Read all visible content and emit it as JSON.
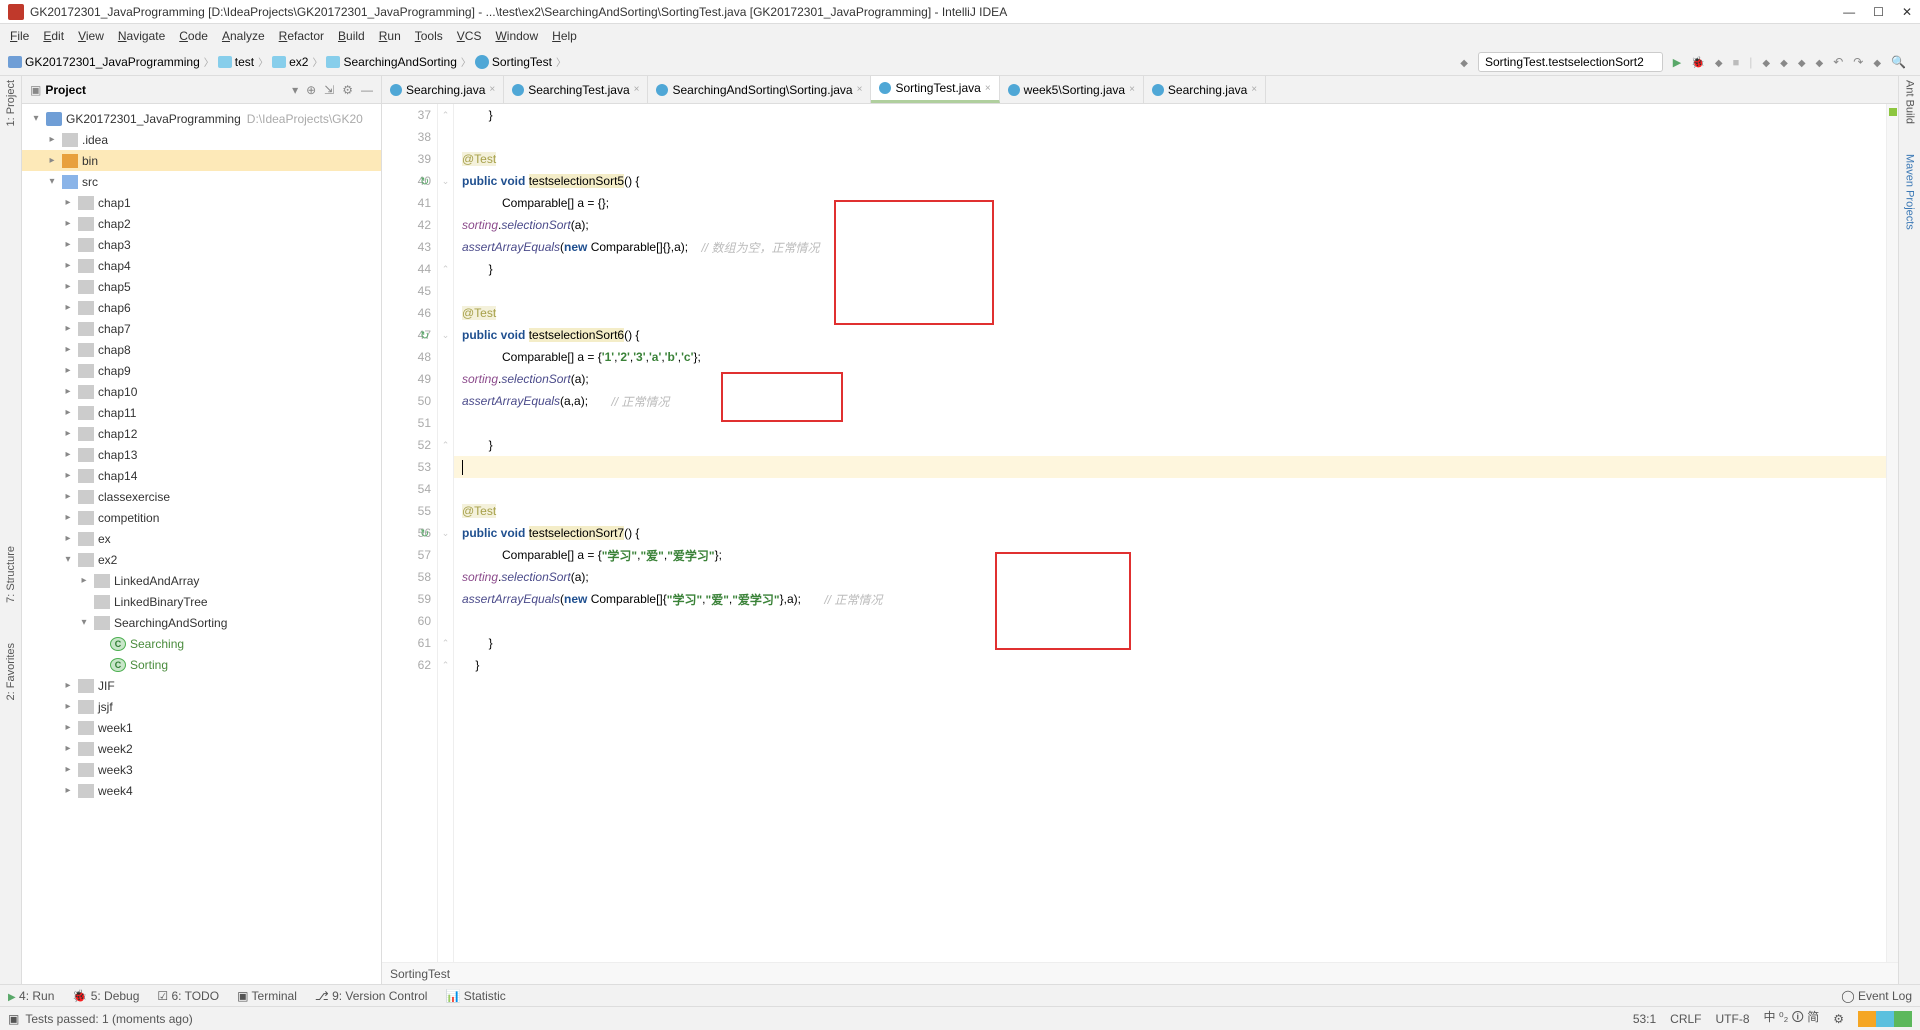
{
  "title": "GK20172301_JavaProgramming [D:\\IdeaProjects\\GK20172301_JavaProgramming] - ...\\test\\ex2\\SearchingAndSorting\\SortingTest.java [GK20172301_JavaProgramming] - IntelliJ IDEA",
  "menu": [
    "File",
    "Edit",
    "View",
    "Navigate",
    "Code",
    "Analyze",
    "Refactor",
    "Build",
    "Run",
    "Tools",
    "VCS",
    "Window",
    "Help"
  ],
  "breadcrumb": [
    "GK20172301_JavaProgramming",
    "test",
    "ex2",
    "SearchingAndSorting",
    "SortingTest"
  ],
  "runConfig": "SortingTest.testselectionSort2",
  "projectPanel": {
    "title": "Project"
  },
  "tree": {
    "module": "GK20172301_JavaProgramming",
    "moduleHint": "D:\\IdeaProjects\\GK20",
    "idea": ".idea",
    "bin": "bin",
    "src": "src",
    "chaps": [
      "chap1",
      "chap2",
      "chap3",
      "chap4",
      "chap5",
      "chap6",
      "chap7",
      "chap8",
      "chap9",
      "chap10",
      "chap11",
      "chap12",
      "chap13",
      "chap14"
    ],
    "classex": "classexercise",
    "competition": "competition",
    "ex": "ex",
    "ex2": "ex2",
    "linkedArr": "LinkedAndArray",
    "linkedBin": "LinkedBinaryTree",
    "sas": "SearchingAndSorting",
    "searching": "Searching",
    "sorting": "Sorting",
    "jif": "JIF",
    "jsjf": "jsjf",
    "weeks": [
      "week1",
      "week2",
      "week3",
      "week4"
    ]
  },
  "tabs": [
    {
      "label": "Searching.java"
    },
    {
      "label": "SearchingTest.java"
    },
    {
      "label": "SearchingAndSorting\\Sorting.java"
    },
    {
      "label": "SortingTest.java",
      "active": true
    },
    {
      "label": "week5\\Sorting.java"
    },
    {
      "label": "Searching.java"
    }
  ],
  "lines": [
    {
      "n": 37,
      "indent": 2,
      "tokens": [
        {
          "t": "}"
        }
      ]
    },
    {
      "n": 38,
      "indent": 0,
      "tokens": []
    },
    {
      "n": 39,
      "indent": 2,
      "tokens": [
        {
          "t": "@Test",
          "c": "hl-ann"
        }
      ]
    },
    {
      "n": 40,
      "indent": 2,
      "run": true,
      "tokens": [
        {
          "t": "public ",
          "c": "hl-kw"
        },
        {
          "t": "void ",
          "c": "hl-kw"
        },
        {
          "t": "testselectionSort5",
          "c": "hl-name"
        },
        {
          "t": "() {"
        }
      ]
    },
    {
      "n": 41,
      "indent": 3,
      "tokens": [
        {
          "t": "Comparable[] a = {};"
        }
      ]
    },
    {
      "n": 42,
      "indent": 3,
      "tokens": [
        {
          "t": "sorting",
          "c": "hl-field"
        },
        {
          "t": "."
        },
        {
          "t": "selectionSort",
          "c": "hl-call"
        },
        {
          "t": "(a);"
        }
      ]
    },
    {
      "n": 43,
      "indent": 3,
      "tokens": [
        {
          "t": "assertArrayEquals",
          "c": "hl-call"
        },
        {
          "t": "("
        },
        {
          "t": "new ",
          "c": "hl-kw"
        },
        {
          "t": "Comparable[]{},a);    "
        },
        {
          "t": "// 数组为空，正常情况",
          "c": "hl-comment"
        }
      ]
    },
    {
      "n": 44,
      "indent": 2,
      "tokens": [
        {
          "t": "}"
        }
      ]
    },
    {
      "n": 45,
      "indent": 0,
      "tokens": []
    },
    {
      "n": 46,
      "indent": 2,
      "tokens": [
        {
          "t": "@Test",
          "c": "hl-ann"
        }
      ]
    },
    {
      "n": 47,
      "indent": 2,
      "run": true,
      "tokens": [
        {
          "t": "public ",
          "c": "hl-kw"
        },
        {
          "t": "void ",
          "c": "hl-kw"
        },
        {
          "t": "testselectionSort6",
          "c": "hl-name"
        },
        {
          "t": "() {"
        }
      ]
    },
    {
      "n": 48,
      "indent": 3,
      "tokens": [
        {
          "t": "Comparable[] a = {"
        },
        {
          "t": "'1'",
          "c": "hl-str"
        },
        {
          "t": ","
        },
        {
          "t": "'2'",
          "c": "hl-str"
        },
        {
          "t": ","
        },
        {
          "t": "'3'",
          "c": "hl-str"
        },
        {
          "t": ","
        },
        {
          "t": "'a'",
          "c": "hl-str"
        },
        {
          "t": ","
        },
        {
          "t": "'b'",
          "c": "hl-str"
        },
        {
          "t": ","
        },
        {
          "t": "'c'",
          "c": "hl-str"
        },
        {
          "t": "};"
        }
      ]
    },
    {
      "n": 49,
      "indent": 3,
      "tokens": [
        {
          "t": "sorting",
          "c": "hl-field"
        },
        {
          "t": "."
        },
        {
          "t": "selectionSort",
          "c": "hl-call"
        },
        {
          "t": "(a);"
        }
      ]
    },
    {
      "n": 50,
      "indent": 3,
      "tokens": [
        {
          "t": "assertArrayEquals",
          "c": "hl-call"
        },
        {
          "t": "(a,a);       "
        },
        {
          "t": "// 正常情况",
          "c": "hl-comment"
        }
      ]
    },
    {
      "n": 51,
      "indent": 0,
      "tokens": []
    },
    {
      "n": 52,
      "indent": 2,
      "tokens": [
        {
          "t": "}"
        }
      ]
    },
    {
      "n": 53,
      "indent": 0,
      "current": true,
      "tokens": [
        {
          "t": "",
          "caret": true
        }
      ]
    },
    {
      "n": 54,
      "indent": 0,
      "tokens": []
    },
    {
      "n": 55,
      "indent": 2,
      "tokens": [
        {
          "t": "@Test",
          "c": "hl-ann"
        }
      ]
    },
    {
      "n": 56,
      "indent": 2,
      "run": true,
      "tokens": [
        {
          "t": "public ",
          "c": "hl-kw"
        },
        {
          "t": "void ",
          "c": "hl-kw"
        },
        {
          "t": "testselectionSort7",
          "c": "hl-name"
        },
        {
          "t": "() {"
        }
      ]
    },
    {
      "n": 57,
      "indent": 3,
      "tokens": [
        {
          "t": "Comparable[] a = {"
        },
        {
          "t": "\"学习\"",
          "c": "hl-str"
        },
        {
          "t": ","
        },
        {
          "t": "\"爱\"",
          "c": "hl-str"
        },
        {
          "t": ","
        },
        {
          "t": "\"爱学习\"",
          "c": "hl-str"
        },
        {
          "t": "};"
        }
      ]
    },
    {
      "n": 58,
      "indent": 3,
      "tokens": [
        {
          "t": "sorting",
          "c": "hl-field"
        },
        {
          "t": "."
        },
        {
          "t": "selectionSort",
          "c": "hl-call"
        },
        {
          "t": "(a);"
        }
      ]
    },
    {
      "n": 59,
      "indent": 3,
      "tokens": [
        {
          "t": "assertArrayEquals",
          "c": "hl-call"
        },
        {
          "t": "("
        },
        {
          "t": "new ",
          "c": "hl-kw"
        },
        {
          "t": "Comparable[]{"
        },
        {
          "t": "\"学习\"",
          "c": "hl-str"
        },
        {
          "t": ","
        },
        {
          "t": "\"爱\"",
          "c": "hl-str"
        },
        {
          "t": ","
        },
        {
          "t": "\"爱学习\"",
          "c": "hl-str"
        },
        {
          "t": "},a);       "
        },
        {
          "t": "// 正常情况",
          "c": "hl-comment"
        }
      ]
    },
    {
      "n": 60,
      "indent": 0,
      "tokens": []
    },
    {
      "n": 61,
      "indent": 2,
      "tokens": [
        {
          "t": "}"
        }
      ]
    },
    {
      "n": 62,
      "indent": 1,
      "tokens": [
        {
          "t": "}"
        }
      ]
    }
  ],
  "editorCrumb": "SortingTest",
  "bottomTabs": {
    "run": "4: Run",
    "debug": "5: Debug",
    "todo": "6: TODO",
    "terminal": "Terminal",
    "vcs": "9: Version Control",
    "statistic": "Statistic",
    "eventlog": "Event Log"
  },
  "status": {
    "msg": "Tests passed: 1 (moments ago)",
    "pos": "53:1",
    "crlf": "CRLF",
    "enc": "UTF-8",
    "ime": "中 ⁰₂ 🛈 简"
  },
  "leftTools": [
    "1: Project",
    "7: Structure",
    "2: Favorites"
  ],
  "rightTools": [
    "Ant Build",
    "Maven Projects"
  ]
}
